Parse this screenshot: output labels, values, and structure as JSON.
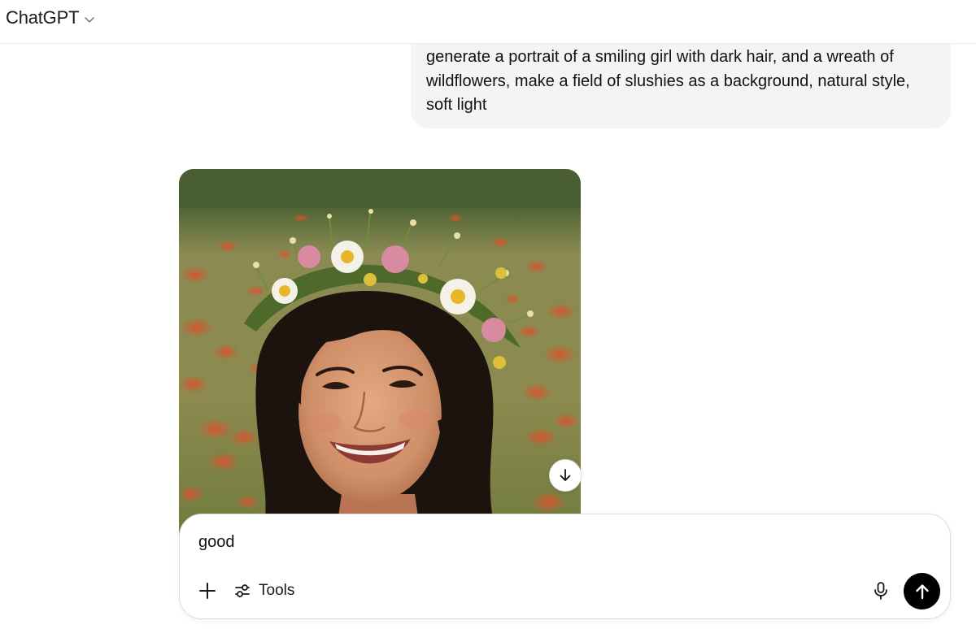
{
  "header": {
    "model_name": "ChatGPT",
    "chevron_icon": "chevron-down-icon"
  },
  "conversation": {
    "user_message": "generate a portrait of a smiling girl with dark hair, and a wreath of wildflowers, make a field of slushies as a background, natural style, soft light",
    "assistant_image": {
      "download_icon": "arrow-down-icon"
    }
  },
  "composer": {
    "input_value": "good",
    "plus_icon": "plus-icon",
    "tools_icon": "sliders-icon",
    "tools_label": "Tools",
    "mic_icon": "microphone-icon",
    "send_icon": "arrow-up-icon"
  },
  "colors": {
    "bubble_bg": "#f4f4f4",
    "send_button": "#000000"
  }
}
